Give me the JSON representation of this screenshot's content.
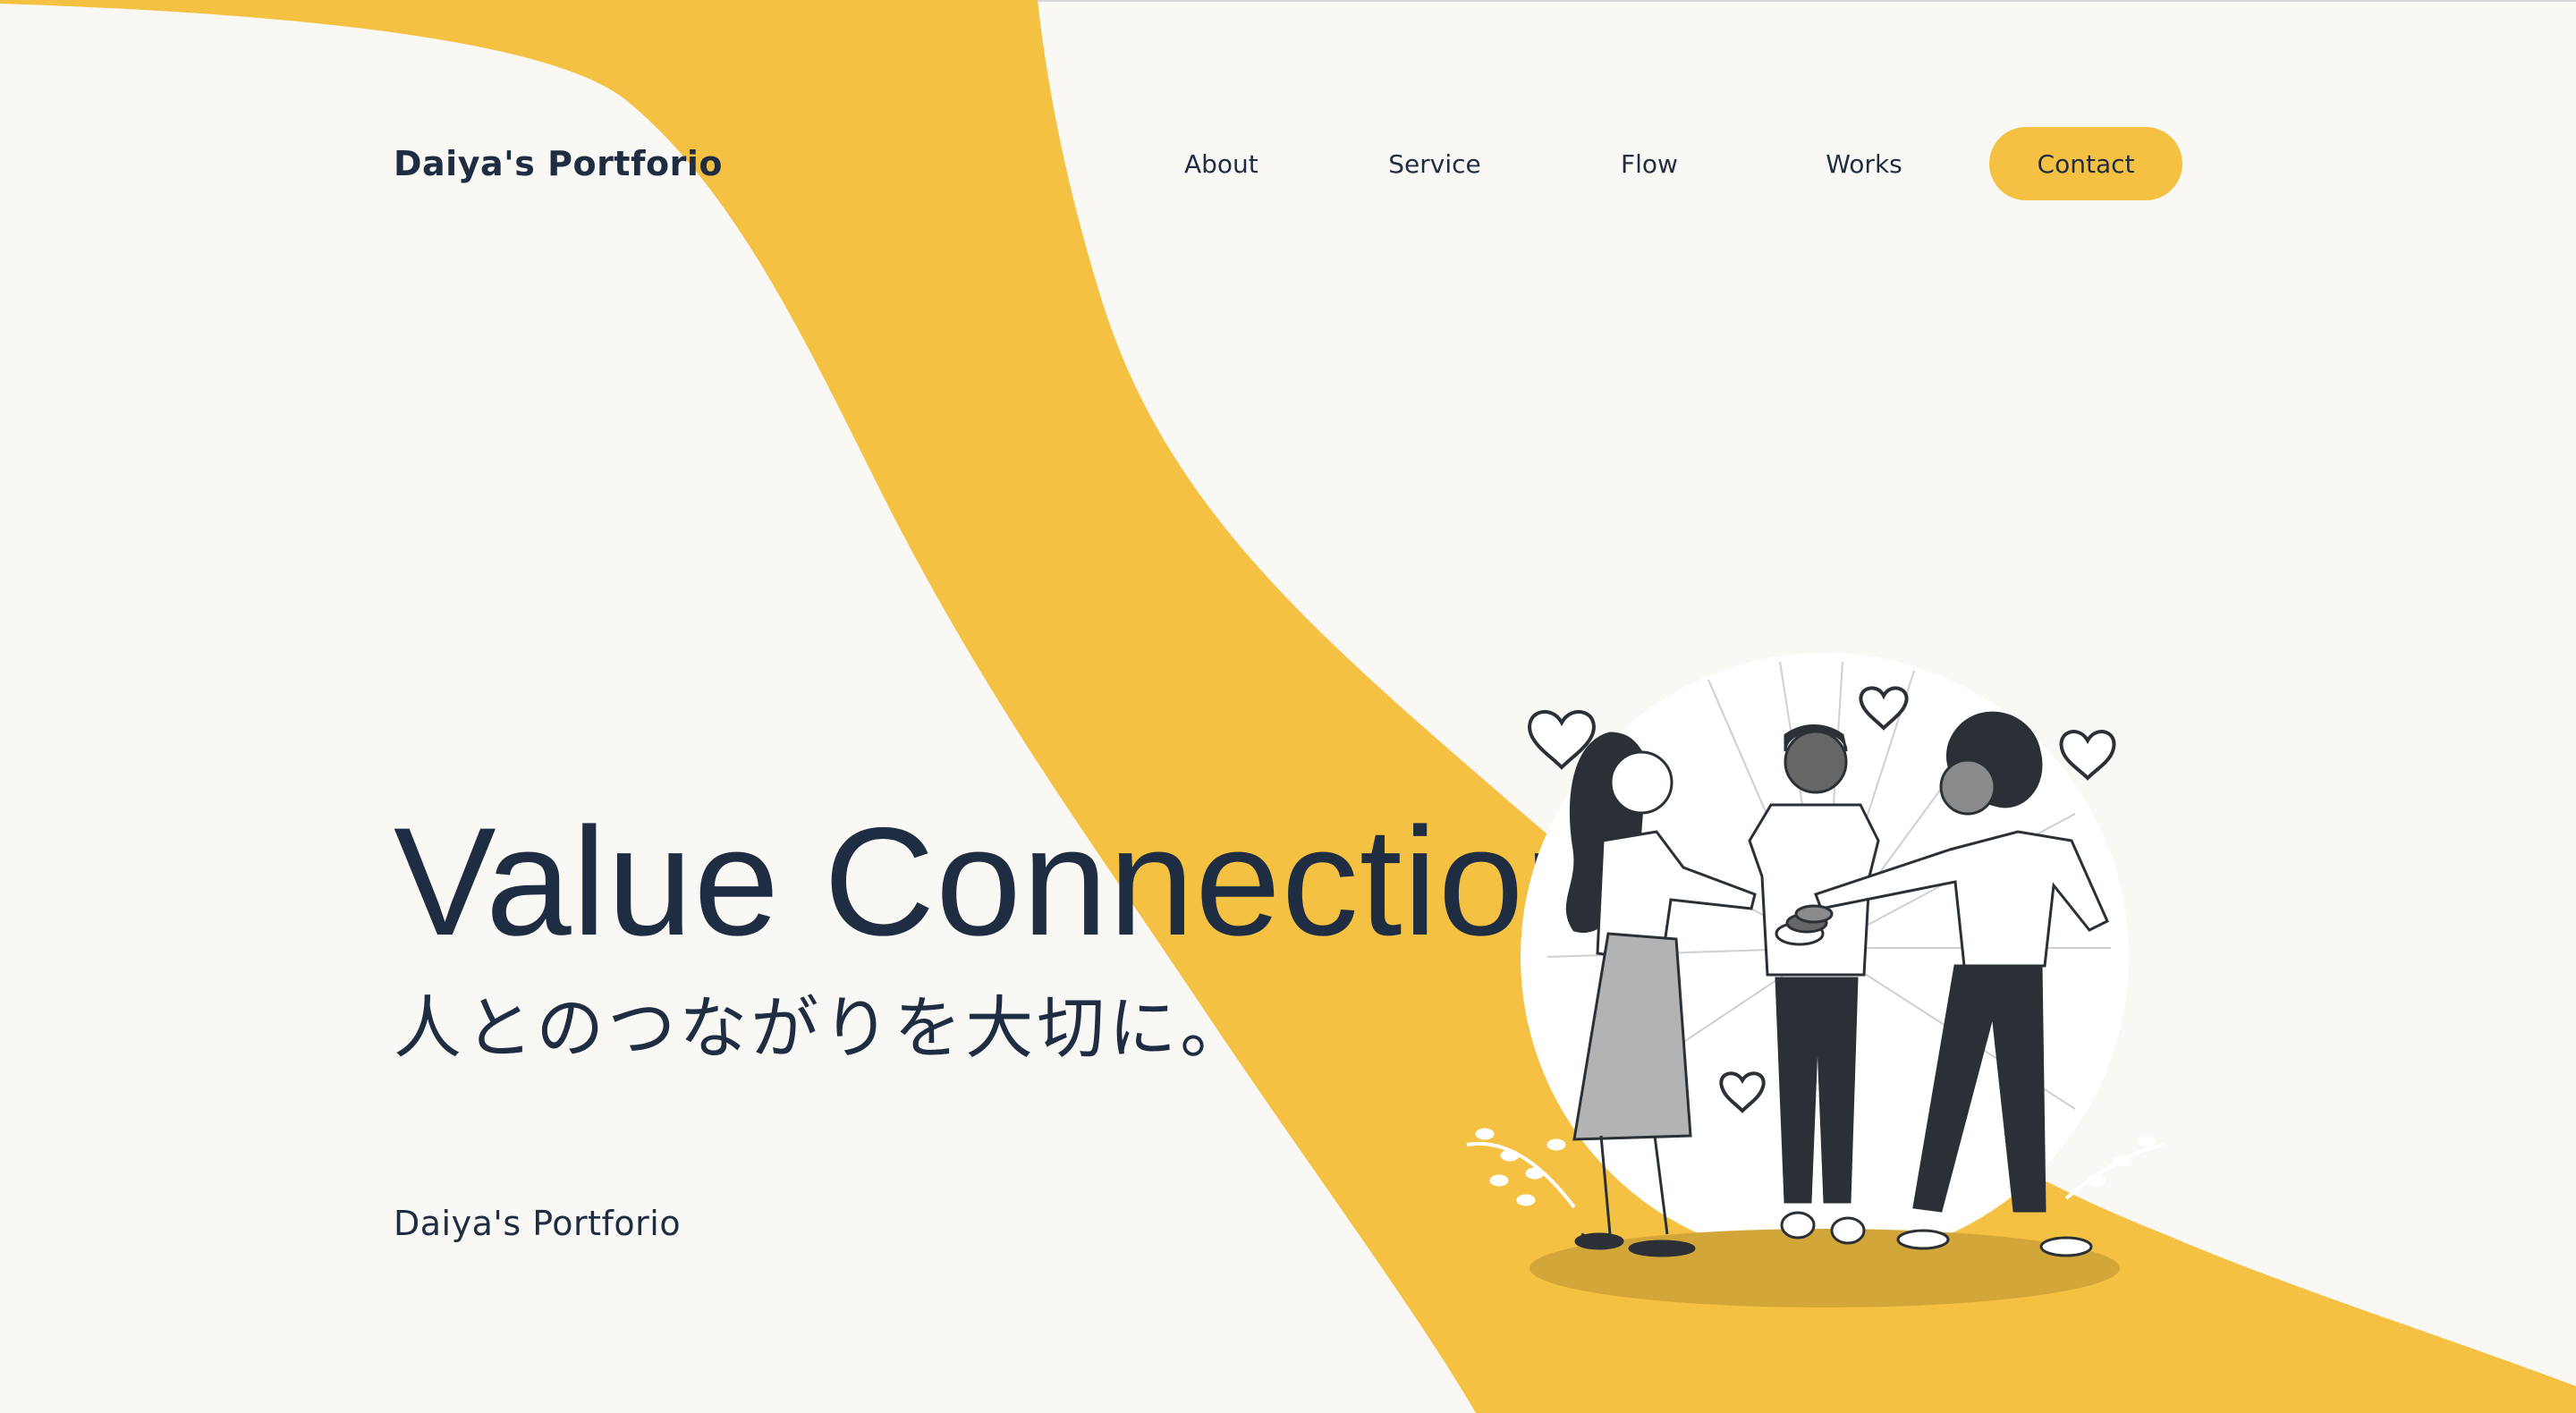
{
  "header": {
    "logo": "Daiya's Portforio",
    "nav": [
      {
        "label": "About"
      },
      {
        "label": "Service"
      },
      {
        "label": "Flow"
      },
      {
        "label": "Works"
      }
    ],
    "contact_label": "Contact"
  },
  "hero": {
    "title": "Value Connection",
    "subtitle": "人とのつながりを大切に。",
    "tagline": "Daiya's Portforio"
  },
  "colors": {
    "background": "#f9f8f5",
    "accent": "#f5c143",
    "text": "#1f2d42",
    "dark": "#2a3036"
  },
  "illustration": {
    "icons": [
      "heart-icon",
      "leaf-icon"
    ]
  }
}
